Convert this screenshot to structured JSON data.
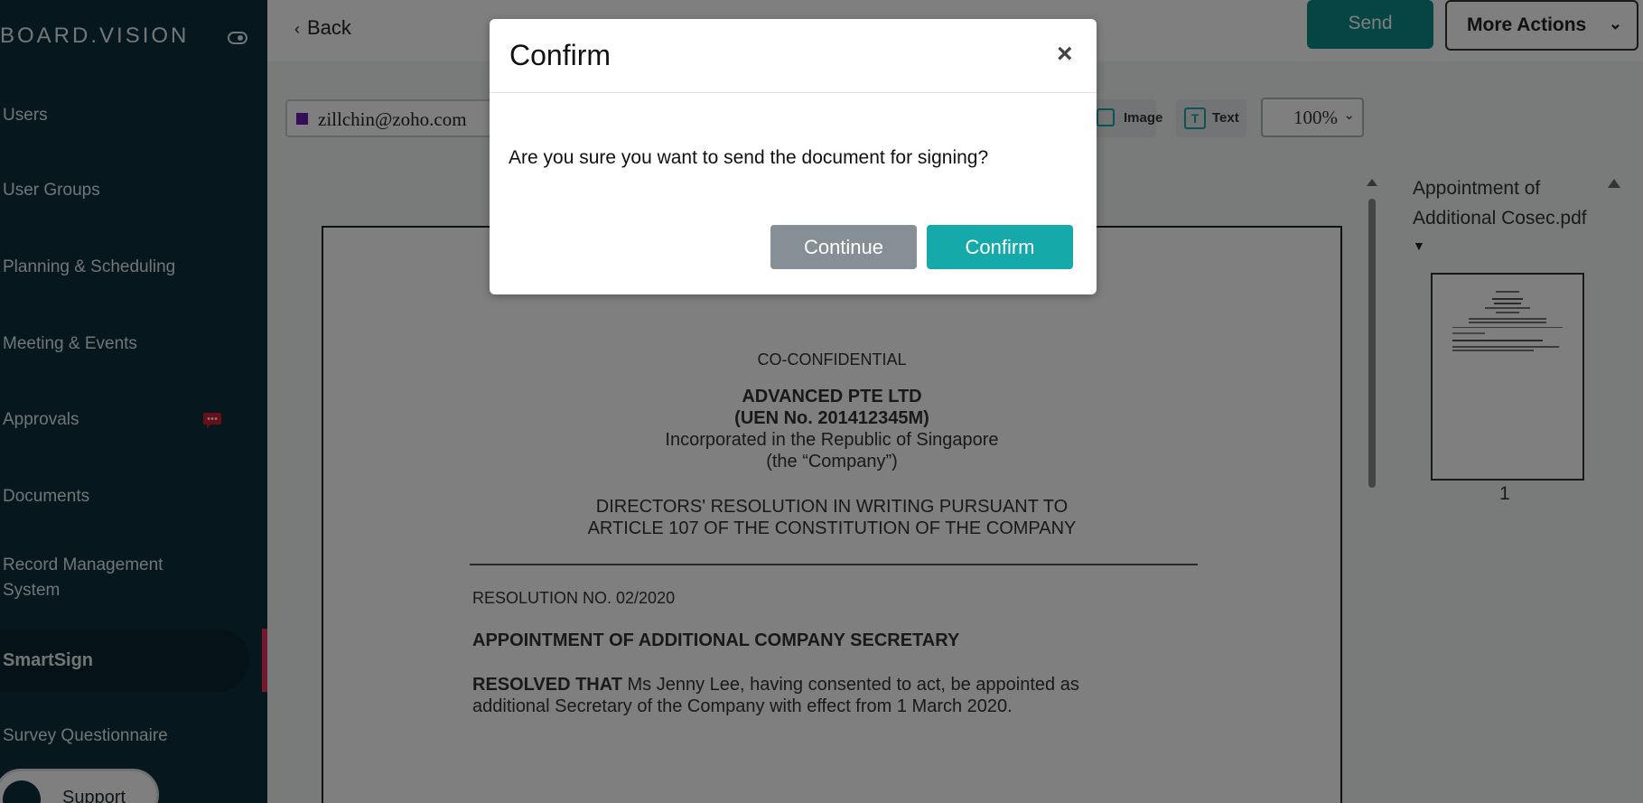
{
  "sidebar": {
    "brand": "BOARD.VISION",
    "items": [
      {
        "label": "Users"
      },
      {
        "label": "User Groups"
      },
      {
        "label": "Planning & Scheduling"
      },
      {
        "label": "Meeting & Events"
      },
      {
        "label": "Approvals"
      },
      {
        "label": "Documents"
      },
      {
        "label": "Record Management"
      },
      {
        "label": "System"
      },
      {
        "label": "SmartSign"
      },
      {
        "label": "Survey Questionnaire"
      }
    ],
    "support_label": "Support",
    "accent_color": "#e8305c"
  },
  "header": {
    "back_label": "Back",
    "send_label": "Send",
    "more_actions_label": "More Actions"
  },
  "toolbar": {
    "signer_email": "zillchin@zoho.com",
    "image_label": "Image",
    "text_label": "Text",
    "zoom": "100%"
  },
  "document": {
    "classification": "CO-CONFIDENTIAL",
    "company": "ADVANCED PTE LTD",
    "uen": "(UEN No. 201412345M)",
    "incorporated": "Incorporated in the Republic of Singapore",
    "company_alias": "(the “Company”)",
    "resolution_title_1": "DIRECTORS' RESOLUTION IN WRITING PURSUANT TO",
    "resolution_title_2": "ARTICLE 107 OF THE CONSTITUTION OF THE COMPANY",
    "resolution_no": "RESOLUTION NO. 02/2020",
    "heading": "APPOINTMENT OF ADDITIONAL COMPANY SECRETARY",
    "resolved_lead": "RESOLVED THAT",
    "resolved_text_1": " Ms Jenny Lee, having consented to act, be appointed as",
    "resolved_text_2": "additional Secretary of the Company with effect from 1 March 2020."
  },
  "pages_panel": {
    "file_name": "Appointment of Additional Cosec.pdf",
    "page_number": "1"
  },
  "modal": {
    "title": "Confirm",
    "close_symbol": "×",
    "message": "Are you sure you want to send the document for signing?",
    "continue_label": "Continue",
    "confirm_label": "Confirm"
  }
}
